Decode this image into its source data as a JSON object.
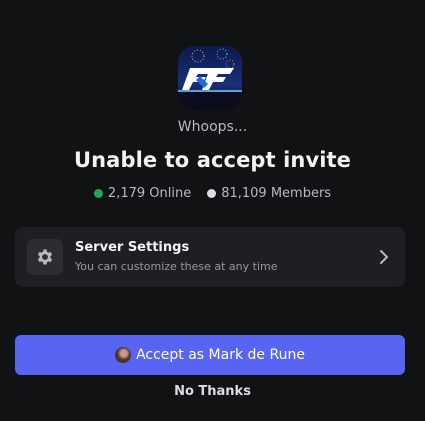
{
  "invite": {
    "eyebrow": "Whoops...",
    "title": "Unable to accept invite",
    "online_text": "2,179 Online",
    "members_text": "81,109 Members",
    "online_color": "#23a55a",
    "members_color": "#dbdee1"
  },
  "server_settings": {
    "title": "Server Settings",
    "subtitle": "You can customize these at any time",
    "icon": "gear-icon"
  },
  "actions": {
    "accept_label": "Accept as Mark de Rune",
    "decline_label": "No Thanks",
    "accent_color": "#5865f2"
  }
}
